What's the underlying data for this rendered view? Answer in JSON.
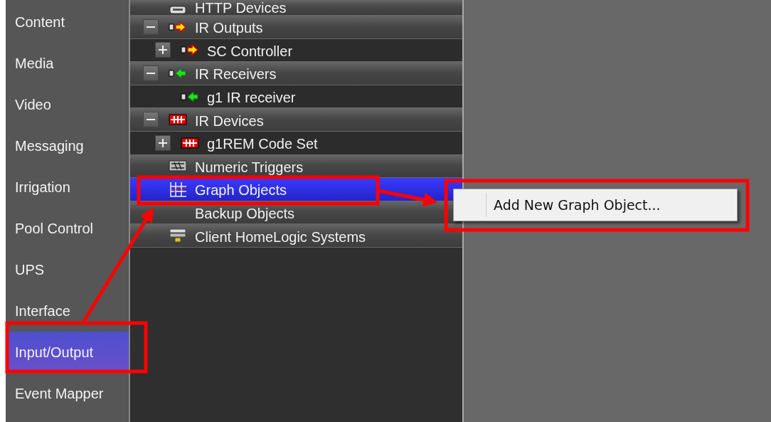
{
  "sidebar": {
    "items": [
      {
        "label": "Content",
        "selected": false
      },
      {
        "label": "Media",
        "selected": false
      },
      {
        "label": "Video",
        "selected": false
      },
      {
        "label": "Messaging",
        "selected": false
      },
      {
        "label": "Irrigation",
        "selected": false
      },
      {
        "label": "Pool Control",
        "selected": false
      },
      {
        "label": "UPS",
        "selected": false
      },
      {
        "label": "Interface",
        "selected": false
      },
      {
        "label": "Input/Output",
        "selected": true
      },
      {
        "label": "Event Mapper",
        "selected": false
      }
    ]
  },
  "tree": [
    {
      "label": "HTTP Devices",
      "kind": "http",
      "selected": false
    },
    {
      "label": "IR Outputs",
      "kind": "output",
      "expanded": true,
      "selected": false,
      "children": [
        {
          "label": "SC Controller",
          "kind": "output",
          "expanded": false,
          "selected": false
        }
      ]
    },
    {
      "label": "IR Receivers",
      "kind": "receiver",
      "expanded": true,
      "selected": false,
      "children": [
        {
          "label": "g1 IR receiver",
          "kind": "receiver",
          "selected": false
        }
      ]
    },
    {
      "label": "IR Devices",
      "kind": "device",
      "expanded": true,
      "selected": false,
      "children": [
        {
          "label": "g1REM Code Set",
          "kind": "device",
          "expanded": false,
          "selected": false
        }
      ]
    },
    {
      "label": "Numeric Triggers",
      "kind": "numeric",
      "selected": false
    },
    {
      "label": "Graph Objects",
      "kind": "graph",
      "selected": true
    },
    {
      "label": "Backup Objects",
      "selected": false
    },
    {
      "label": "Client HomeLogic Systems",
      "kind": "client",
      "selected": false
    }
  ],
  "context_menu": {
    "items": [
      {
        "label": "Add New Graph Object..."
      }
    ]
  }
}
